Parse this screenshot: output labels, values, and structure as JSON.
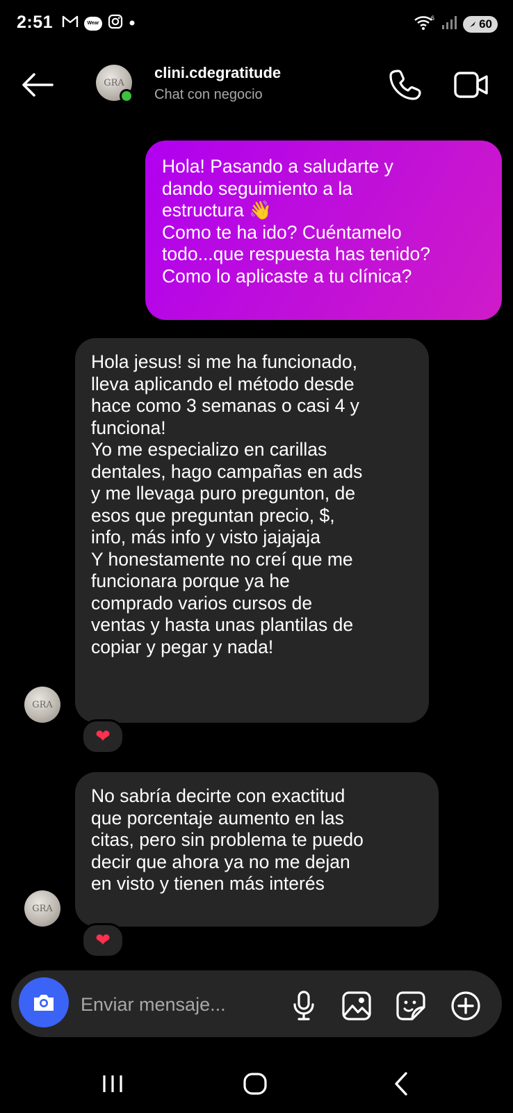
{
  "status_bar": {
    "time": "2:51",
    "left_icons": [
      "gmail-icon",
      "wear-icon",
      "instagram-icon",
      "dot-icon"
    ],
    "wear_label": "Wear",
    "right_icons": [
      "wifi-icon",
      "signal-icon"
    ],
    "battery_level": "60"
  },
  "header": {
    "contact_name": "clini.cdegratitude",
    "subtitle": "Chat con negocio",
    "online": true
  },
  "avatar_text": "GRA",
  "messages": [
    {
      "direction": "outgoing",
      "text": "Hola! Pasando a saludarte y\ndando seguimiento a la\nestructura 👋\nComo te ha ido? Cuéntamelo\ntodo...que respuesta has tenido?\nComo lo aplicaste a tu clínica?"
    },
    {
      "direction": "incoming",
      "text": "Hola jesus! si me ha funcionado,\nlleva aplicando el método desde\nhace como 3 semanas o casi 4 y\nfunciona!\nYo me especializo en carillas\ndentales, hago campañas en ads\ny me llevaga puro pregunton, de\nesos que preguntan precio, $,\ninfo, más info y visto jajajaja\nY honestamente no creí que me\nfuncionara porque ya he\ncomprado varios cursos de\nventas y hasta unas plantilas de\ncopiar y pegar y nada!",
      "reaction": "❤"
    },
    {
      "direction": "incoming",
      "text": "No sabría decirte con exactitud\nque porcentaje aumento en las\ncitas, pero sin problema te puedo\ndecir que ahora ya no me dejan\nen  visto y tienen más interés",
      "reaction": "❤"
    }
  ],
  "composer": {
    "placeholder": "Enviar mensaje...",
    "icons": [
      "camera-icon",
      "microphone-icon",
      "gallery-icon",
      "sticker-icon",
      "plus-icon"
    ]
  },
  "nav_bar": {
    "icons": [
      "recent-apps-icon",
      "home-icon",
      "back-icon"
    ]
  },
  "colors": {
    "background": "#000000",
    "incoming_bubble": "#262626",
    "outgoing_bubble_start": "#b000f0",
    "outgoing_bubble_end": "#cf1bc8",
    "camera_button": "#3b63f5",
    "online_dot": "#3fbf3f",
    "heart": "#ff3050"
  }
}
